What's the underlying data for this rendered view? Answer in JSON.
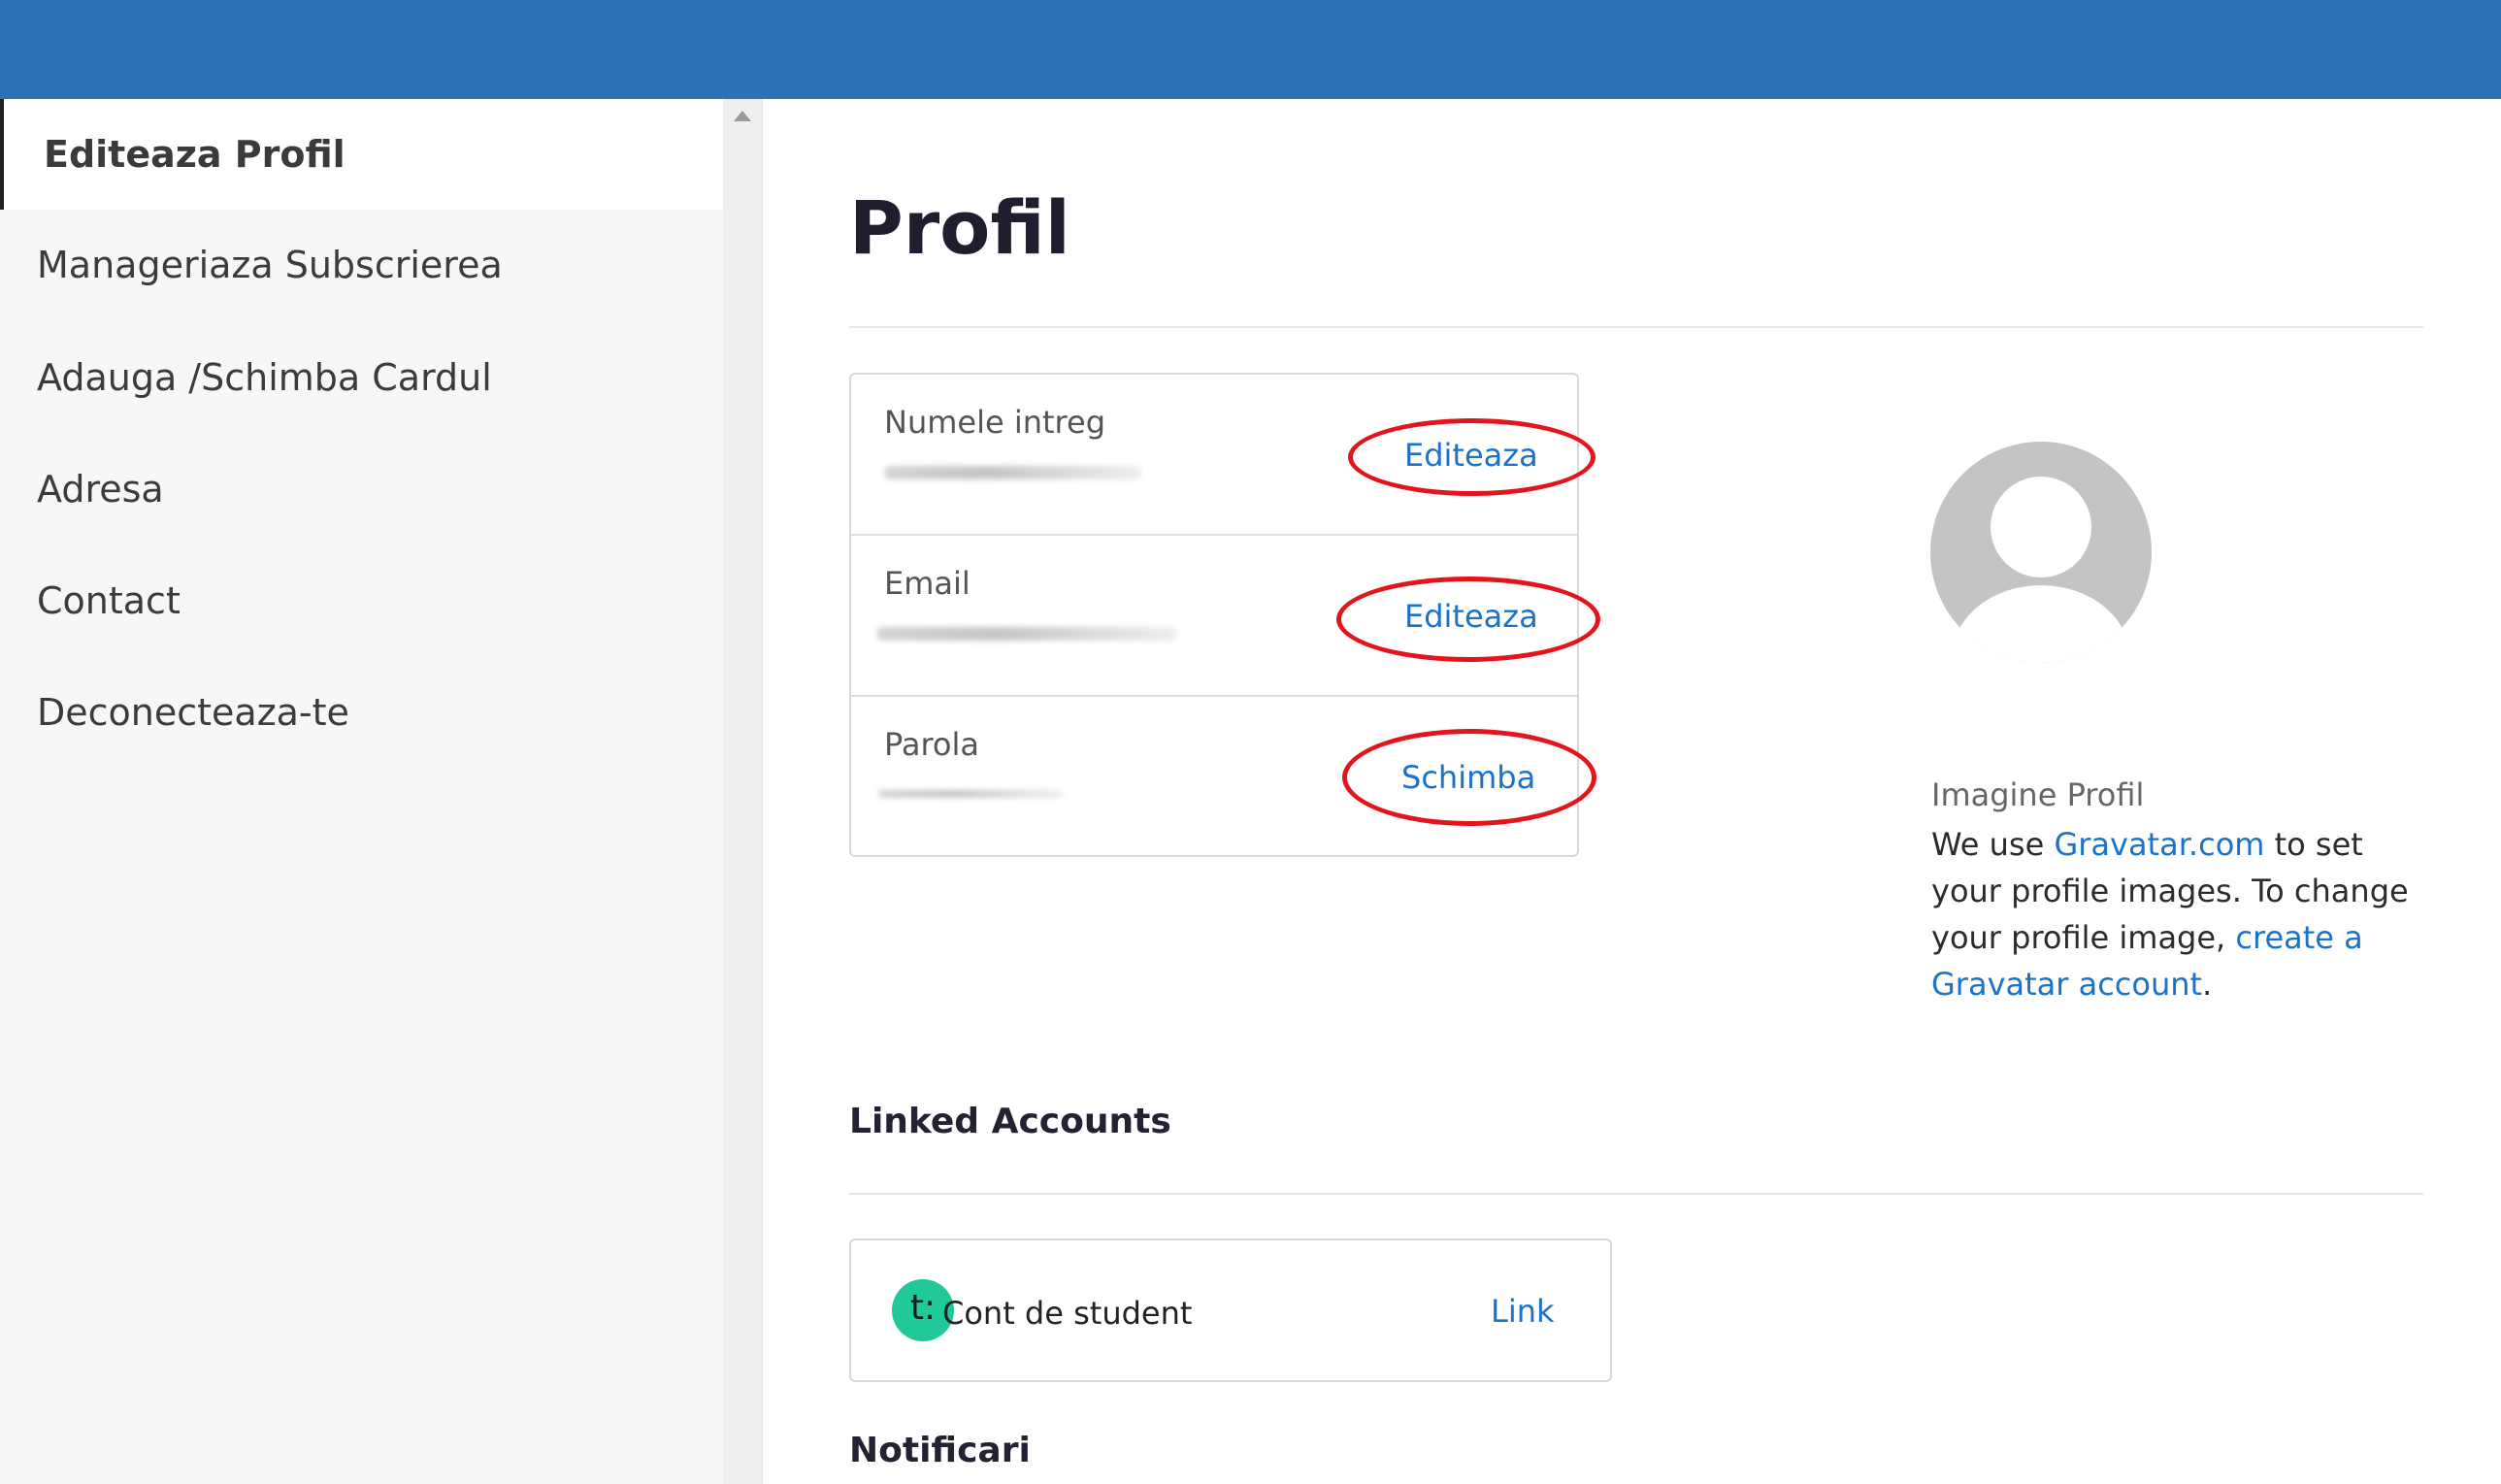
{
  "sidebar": {
    "items": [
      {
        "label": "Editeaza Profil",
        "active": true
      },
      {
        "label": "Manageriaza Subscrierea"
      },
      {
        "label": "Adauga /Schimba Cardul"
      },
      {
        "label": "Adresa"
      },
      {
        "label": "Contact"
      },
      {
        "label": "Deconecteaza-te"
      }
    ]
  },
  "main": {
    "title": "Profil",
    "fields": [
      {
        "label": "Numele intreg",
        "action": "Editeaza"
      },
      {
        "label": "Email",
        "action": "Editeaza"
      },
      {
        "label": "Parola",
        "action": "Schimba"
      }
    ],
    "profile_image": {
      "label": "Imagine Profil",
      "text_1": "We use ",
      "gravatar_link": "Gravatar.com",
      "text_2": " to set your profile images. To change your profile image, ",
      "create_link": "create a Gravatar account",
      "text_3": "."
    },
    "linked_accounts": {
      "title": "Linked Accounts",
      "accounts": [
        {
          "badge": "t:",
          "name": "Cont de student",
          "action": "Link",
          "badge_color": "#20c997"
        }
      ]
    },
    "notifications": {
      "title": "Notificari"
    }
  },
  "colors": {
    "header": "#2d72b5",
    "link": "#1a73c8",
    "highlight": "#e2141c"
  }
}
